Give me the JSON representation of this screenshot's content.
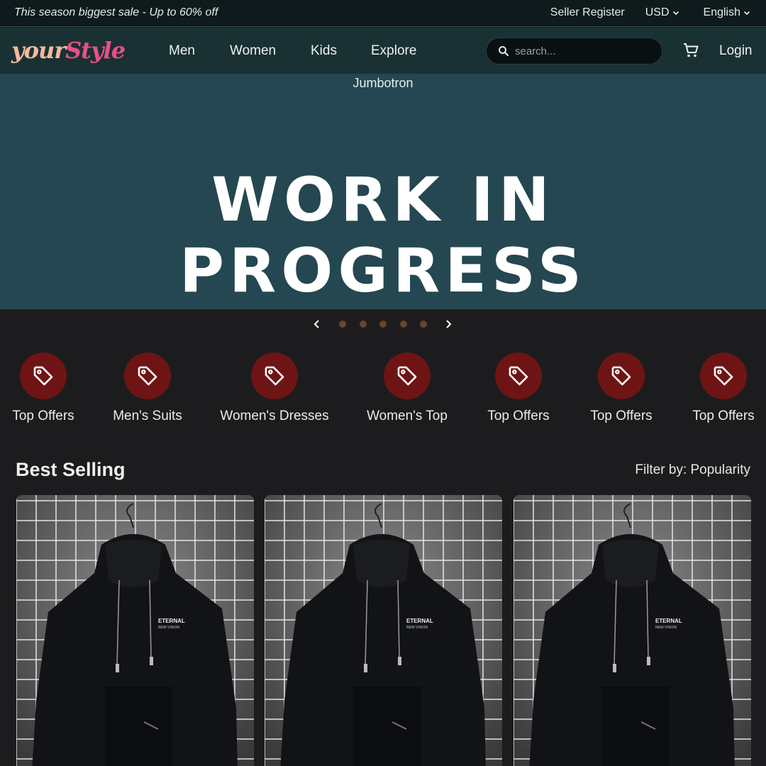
{
  "topbar": {
    "promo": "This season biggest sale - Up to 60% off",
    "seller_register": "Seller Register",
    "currency": "USD",
    "language": "English"
  },
  "navbar": {
    "logo_part1": "your",
    "logo_part2": "Style",
    "links": [
      "Men",
      "Women",
      "Kids",
      "Explore"
    ],
    "search_placeholder": "search...",
    "login": "Login"
  },
  "hero": {
    "label": "Jumbotron",
    "title": "WORK IN PROGRESS",
    "background": "#244751"
  },
  "carousel": {
    "dots": 5
  },
  "categories": [
    {
      "label": "Top Offers",
      "icon": "tag-icon"
    },
    {
      "label": "Men's Suits",
      "icon": "tag-icon"
    },
    {
      "label": "Women's Dresses",
      "icon": "tag-icon"
    },
    {
      "label": "Women's Top",
      "icon": "tag-icon"
    },
    {
      "label": "Top Offers",
      "icon": "tag-icon"
    },
    {
      "label": "Top Offers",
      "icon": "tag-icon"
    },
    {
      "label": "Top Offers",
      "icon": "tag-icon"
    }
  ],
  "best_selling": {
    "title": "Best Selling",
    "filter": "Filter by: Popularity",
    "products": [
      {
        "print_line1": "ETERNAL",
        "print_line2": "NEW VISION"
      },
      {
        "print_line1": "ETERNAL",
        "print_line2": "NEW VISION"
      },
      {
        "print_line1": "ETERNAL",
        "print_line2": "NEW VISION"
      }
    ]
  },
  "colors": {
    "category_circle": "#6e1414",
    "carousel_dot": "#6b4526",
    "logo_primary": "#f3b9a0",
    "logo_accent": "#e8508a"
  }
}
